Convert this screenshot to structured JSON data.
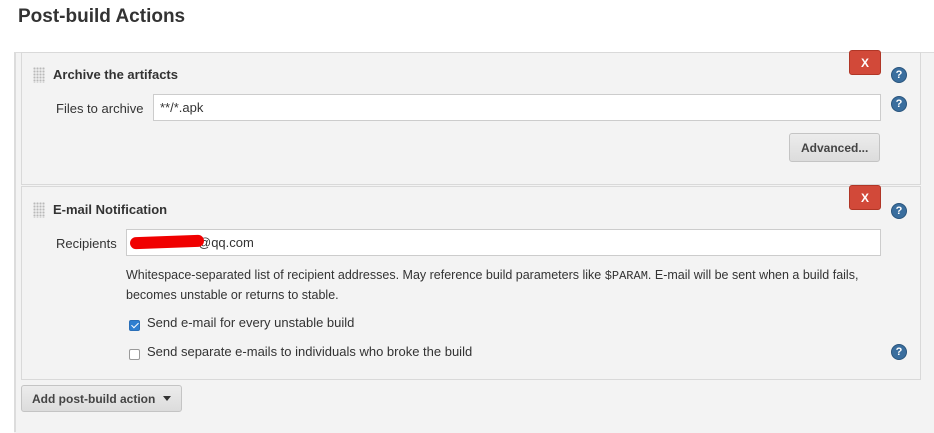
{
  "page": {
    "title": "Post-build Actions"
  },
  "archive": {
    "title": "Archive the artifacts",
    "delete_label": "X",
    "files_label": "Files to archive",
    "files_value": "**/*.apk",
    "advanced_label": "Advanced..."
  },
  "email": {
    "title": "E-mail Notification",
    "delete_label": "X",
    "recipients_label": "Recipients",
    "recipients_value": "@qq.com",
    "description_pre": "Whitespace-separated list of recipient addresses. May reference build parameters like ",
    "description_code": "$PARAM",
    "description_post": ". E-mail will be sent when a build fails, becomes unstable or returns to stable.",
    "checkbox_unstable": {
      "label": "Send e-mail for every unstable build",
      "checked": true
    },
    "checkbox_individuals": {
      "label": "Send separate e-mails to individuals who broke the build",
      "checked": false
    }
  },
  "footer": {
    "add_action_label": "Add post-build action"
  },
  "icons": {
    "help": "?",
    "dropdown": "caret-down-icon",
    "drag": "drag-handle-icon"
  },
  "colors": {
    "delete": "#d24939",
    "help": "#3a6e9e",
    "checkbox": "#2f7fd1"
  }
}
